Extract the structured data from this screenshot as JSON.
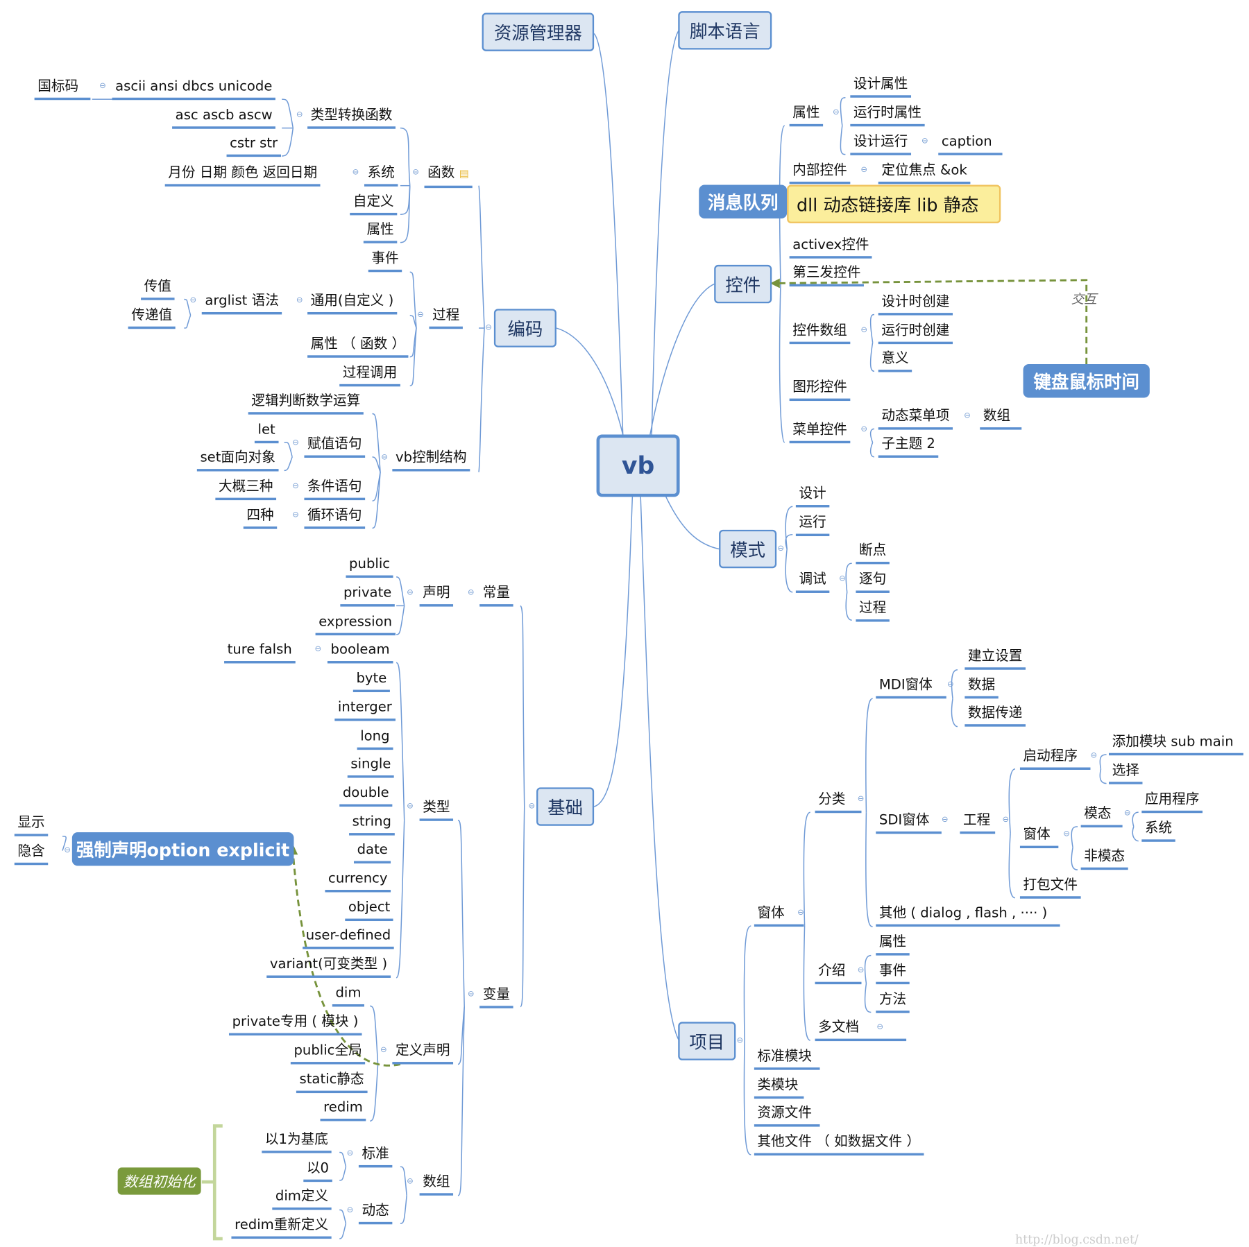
{
  "root": "vb",
  "top_nodes": {
    "explorer": "资源管理器",
    "script": "脚本语言"
  },
  "coding": {
    "title": "编码",
    "functions": {
      "title": "函数",
      "type_conv": {
        "title": "类型转换函数",
        "items": [
          "ascii  ansi  dbcs  unicode",
          "asc   ascb  ascw",
          "cstr  str"
        ],
        "sub": "国标码"
      },
      "system": {
        "title": "系统",
        "detail": "月份  日期  颜色  返回日期"
      },
      "custom": "自定义",
      "property": "属性"
    },
    "procedure": {
      "title": "过程",
      "event": "事件",
      "general": "通用(自定义 )",
      "arglist": "arglist 语法",
      "pass_value": "传值",
      "pass_ref": "传递值",
      "property_func": "属性 （ 函数 ）",
      "call": "过程调用"
    },
    "control": {
      "title": "vb控制结构",
      "logic": "逻辑判断数学运算",
      "assign": "赋值语句",
      "let": "let",
      "set": "set面向对象",
      "condition": "条件语句",
      "cond_detail": "大概三种",
      "loop": "循环语句",
      "loop_detail": "四种"
    }
  },
  "basics": {
    "title": "基础",
    "constant": {
      "title": "常量",
      "declare": "声明",
      "items": [
        "public",
        "private",
        "expression"
      ]
    },
    "variable": {
      "title": "变量",
      "types": {
        "title": "类型",
        "boolean": "booleam",
        "bool_vals": "ture  falsh",
        "items": [
          "byte",
          "interger",
          "long",
          "single",
          "double",
          "string",
          "date",
          "currency",
          "object",
          "user-defined",
          "variant(可变类型 )"
        ]
      },
      "define": {
        "title": "定义声明",
        "items": [
          "dim",
          "private专用 ( 模块 )",
          "public全局",
          "static静态",
          "redim"
        ]
      },
      "array": {
        "title": "数组",
        "standard": "标准",
        "std_items": [
          "以1为基底",
          "以0"
        ],
        "dynamic": "动态",
        "dyn_items": [
          "dim定义",
          "redim重新定义"
        ]
      }
    },
    "option_explicit": "强制声明option explicit",
    "option_items": [
      "显示",
      "隐含"
    ],
    "array_init": "数组初始化"
  },
  "controls": {
    "title": "控件",
    "property": {
      "title": "属性",
      "items": [
        "设计属性",
        "运行时属性",
        "设计运行"
      ],
      "caption": "caption"
    },
    "internal": {
      "title": "内部控件",
      "detail": "定位焦点 &ok"
    },
    "note": "dll 动态链接库  lib 静态",
    "message_queue": "消息队列",
    "activex": "activex控件",
    "third_party": "第三发控件",
    "array": {
      "title": "控件数组",
      "items": [
        "设计时创建",
        "运行时创建",
        "意义"
      ]
    },
    "graphic": "图形控件",
    "menu": {
      "title": "菜单控件",
      "dynamic": "动态菜单项",
      "array": "数组",
      "subtopic": "子主题 2"
    },
    "interaction_label": "交互",
    "keyboard": "键盘鼠标时间"
  },
  "mode": {
    "title": "模式",
    "design": "设计",
    "run": "运行",
    "debug": "调试",
    "debug_items": [
      "断点",
      "逐句",
      "过程"
    ]
  },
  "project": {
    "title": "项目",
    "form": {
      "title": "窗体",
      "category": {
        "title": "分类",
        "mdi": {
          "title": "MDI窗体",
          "items": [
            "建立设置",
            "数据",
            "数据传递"
          ]
        },
        "sdi": {
          "title": "SDI窗体",
          "project": "工程",
          "startup": {
            "title": "启动程序",
            "items": [
              "添加模块 sub main",
              "选择"
            ]
          },
          "form": {
            "title": "窗体",
            "modal": "模态",
            "modal_items": [
              "应用程序",
              "系统"
            ],
            "modeless": "非模态"
          },
          "package": "打包文件"
        },
        "other": "其他 ( dialog , flash , ···· )"
      },
      "intro": {
        "title": "介绍",
        "items": [
          "属性",
          "事件",
          "方法"
        ]
      },
      "mdoc": "多文档"
    },
    "items": [
      "标准模块",
      "类模块",
      "资源文件",
      "其他文件 （ 如数据文件 ）"
    ]
  },
  "watermark": "http://blog.csdn.net/"
}
